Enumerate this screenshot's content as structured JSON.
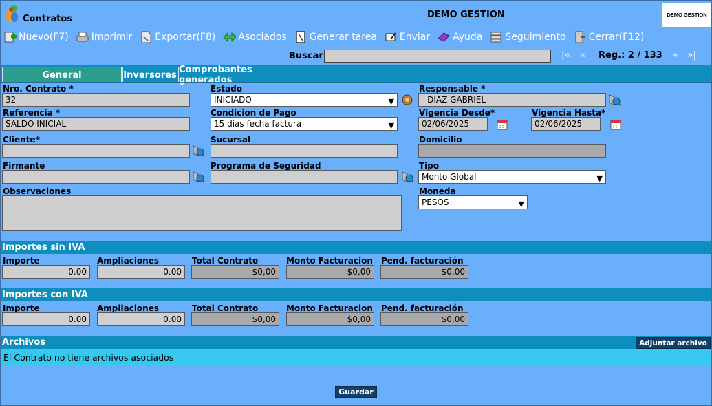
{
  "app": {
    "title": "Contratos",
    "company": "DEMO GESTION",
    "brand": "DEMO GESTION"
  },
  "toolbar": {
    "items": [
      {
        "label": "Nuevo(F7)",
        "icon": "new-icon"
      },
      {
        "label": "Imprimir",
        "icon": "print-icon"
      },
      {
        "label": "Exportar(F8)",
        "icon": "export-icon"
      },
      {
        "label": "Asociados",
        "icon": "associated-icon"
      },
      {
        "label": "Generar tarea",
        "icon": "task-icon"
      },
      {
        "label": "Enviar",
        "icon": "send-icon"
      },
      {
        "label": "Ayuda",
        "icon": "help-icon"
      },
      {
        "label": "Seguimiento",
        "icon": "tracking-icon"
      },
      {
        "label": "Cerrar(F12)",
        "icon": "close-icon"
      }
    ]
  },
  "search": {
    "label": "Buscar",
    "value": ""
  },
  "nav": {
    "first": "|«",
    "prev": "«",
    "next": "»",
    "last": "»|",
    "record": "Reg.: 2 / 133"
  },
  "tabs": [
    "General",
    "Inversores",
    "Comprobantes generados"
  ],
  "form": {
    "nro_contrato": {
      "label": "Nro. Contrato *",
      "value": "32"
    },
    "estado": {
      "label": "Estado",
      "value": "INICIADO"
    },
    "responsable": {
      "label": "Responsable *",
      "value": "- DIAZ GABRIEL"
    },
    "referencia": {
      "label": "Referencia *",
      "value": "SALDO INICIAL"
    },
    "condicion_pago": {
      "label": "Condicion de Pago",
      "value": "15 días fecha factura"
    },
    "vigencia_desde": {
      "label": "Vigencia Desde*",
      "value": "02/06/2025"
    },
    "vigencia_hasta": {
      "label": "Vigencia Hasta*",
      "value": "02/06/2025"
    },
    "cliente": {
      "label": "Cliente*",
      "value": ""
    },
    "sucursal": {
      "label": "Sucursal",
      "value": ""
    },
    "domicilio": {
      "label": "Domicilio",
      "value": ""
    },
    "firmante": {
      "label": "Firmante",
      "value": ""
    },
    "programa_seguridad": {
      "label": "Programa de Seguridad",
      "value": ""
    },
    "tipo": {
      "label": "Tipo",
      "value": "Monto Global"
    },
    "observaciones": {
      "label": "Observaciones",
      "value": ""
    },
    "moneda": {
      "label": "Moneda",
      "value": "PESOS"
    }
  },
  "importes_sin_iva": {
    "title": "Importes sin IVA",
    "labels": [
      "Importe",
      "Ampliaciones",
      "Total Contrato",
      "Monto Facturacion",
      "Pend. facturación"
    ],
    "values": [
      "0.00",
      "0.00",
      "$0,00",
      "$0,00",
      "$0,00"
    ]
  },
  "importes_con_iva": {
    "title": "Importes con IVA",
    "labels": [
      "Importe",
      "Ampliaciones",
      "Total Contrato",
      "Monto Facturacion",
      "Pend. facturación"
    ],
    "values": [
      "0.00",
      "0.00",
      "$0,00",
      "$0,00",
      "$0,00"
    ]
  },
  "archivos": {
    "title": "Archivos",
    "attach_label": "Adjuntar archivo",
    "empty_message": "El Contrato no tiene archivos asociados"
  },
  "save_label": "Guardar",
  "colors": {
    "background": "#6aaffb",
    "section_bar": "#0d8ebd",
    "active_tab": "#2c9c8e",
    "button": "#10416a",
    "files_row": "#36c8ef"
  }
}
